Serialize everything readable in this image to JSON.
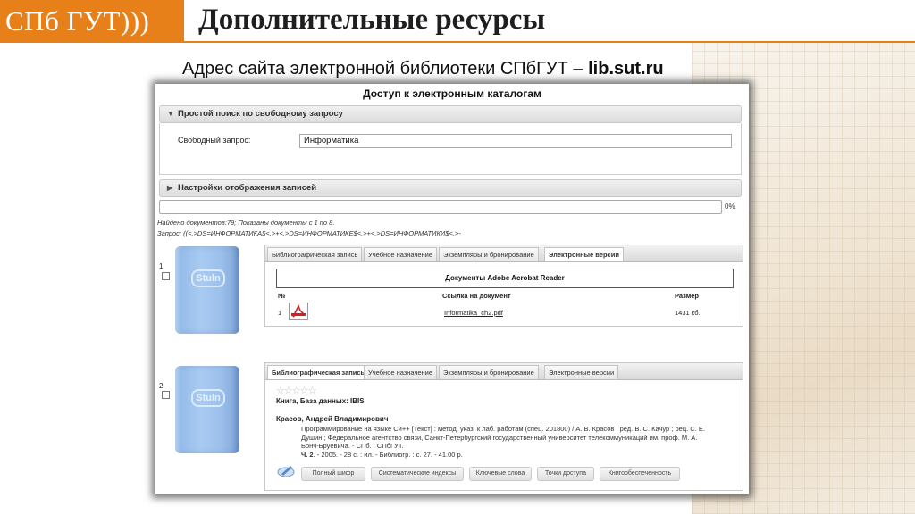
{
  "header": {
    "logo_text": "СПб ГУТ)))",
    "title": "Дополнительные ресурсы",
    "accent_color": "#e8801a"
  },
  "subtitle": {
    "text": "Адрес сайта электронной библиотеки СПбГУТ – ",
    "site": "lib.sut.ru"
  },
  "catalog": {
    "title": "Доступ к электронным каталогам",
    "simple_search": {
      "header": "Простой поиск по свободному запросу",
      "label": "Свободный запрос:",
      "value": "Информатика"
    },
    "display_settings": "Настройки отображения записей",
    "progress": {
      "percent_label": "0%",
      "fraction": 0
    },
    "found_text": "Найдено документов:79; Показаны документы с 1 по 8.",
    "query_text": "Запрос: ((<.>DS=ИНФОРМАТИКА$<.>+<.>DS=ИНФОРМАТИКЕ$<.>+<.>DS=ИНФОРМАТИКИ$<.>-",
    "tabs": [
      "Библиографическая запись",
      "Учебное назначение",
      "Экземпляры и бронирование",
      "Электронные версии"
    ]
  },
  "records": [
    {
      "number": "1",
      "book_label": "Stuln",
      "active_tab": "Электронные версии",
      "adobe_title": "Документы Adobe Acrobat Reader",
      "columns": {
        "num": "№",
        "link": "Ссылка на документ",
        "size": "Размер"
      },
      "file": {
        "num": "1",
        "name": "Informatika_ch2.pdf",
        "size": "1431 кб."
      }
    },
    {
      "number": "2",
      "book_label": "Stuln",
      "active_tab": "Библиографическая запись",
      "stars": "☆☆☆☆☆",
      "kind": "Книга, База данных: IBIS",
      "author": "Красов, Андрей Владимирович",
      "desc_line1": "Программирование на языке Си++ [Текст] : метод. указ. к лаб. работам (спец. 201800) / А. В. Красов ; ред. В. С. Качур ; рец. С. Е.",
      "desc_line2": "Душин ; Федеральное агентство связи, Санкт-Петербургский государственный университет телекоммуникаций им. проф. М. А.",
      "desc_line3": "Бонч-Бруевича. - СПб. : СПбГУТ.",
      "desc_part": "Ч. 2",
      "desc_line4_rest": ". - 2005. - 28 с. : ил. - Библиогр. : с. 27. - 41.00 р.",
      "buttons": [
        "Полный шифр",
        "Систематические индексы",
        "Ключевые слова",
        "Точки доступа",
        "Книгообеспеченность"
      ]
    }
  ]
}
